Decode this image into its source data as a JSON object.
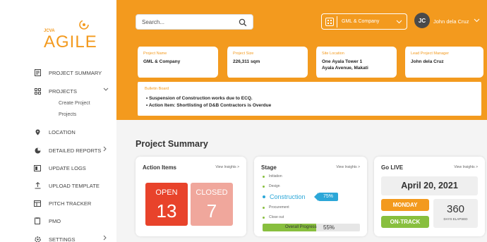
{
  "logo": {
    "small": "JCVA",
    "big": "AGILE"
  },
  "nav": {
    "items": [
      {
        "label": "PROJECT SUMMARY",
        "icon": "document-icon"
      },
      {
        "label": "PROJECTS",
        "icon": "grid-icon"
      },
      {
        "label": "LOCATION",
        "icon": "location-pin-icon"
      },
      {
        "label": "DETAILED REPORTS",
        "icon": "report-icon"
      },
      {
        "label": "UPDATE LOGS",
        "icon": "log-icon"
      },
      {
        "label": "UPLOAD TEMPLATE",
        "icon": "upload-icon"
      },
      {
        "label": "PITCH TRACKER",
        "icon": "tracker-icon"
      },
      {
        "label": "PMO",
        "icon": "clipboard-icon"
      },
      {
        "label": "SETTINGS",
        "icon": "gear-icon"
      }
    ],
    "sub_items": [
      "Create Project",
      "Projects"
    ]
  },
  "header": {
    "search_placeholder": "Search...",
    "company": "GML & Company",
    "avatar_initials": "JC",
    "username": "John dela Cruz"
  },
  "info_cards": [
    {
      "label": "Project Name",
      "value": "GML & Company"
    },
    {
      "label": "Project Size",
      "value": "226,311 sqm"
    },
    {
      "label": "Site Location",
      "value": "One Ayala Tower 1\nAyala Avenue, Makati"
    },
    {
      "label": "Lead Project Manager",
      "value": "John dela Cruz"
    }
  ],
  "bulletin": {
    "label": "Bulletin Board",
    "lines": [
      "• Suspension of Construction works due to ECQ.",
      "• Action Item: Shortlisting of D&B Contractors is Overdue"
    ]
  },
  "section_title": "Project Summary",
  "action_items": {
    "title": "Action Items",
    "view_insights": "View Insights >",
    "open_label": "OPEN",
    "open_count": "13",
    "closed_label": "CLOSED",
    "closed_count": "7",
    "colors": {
      "open": "#e8432b",
      "closed": "#f0a79c"
    }
  },
  "stage": {
    "title": "Stage",
    "view_insights": "View Insights >",
    "stages": [
      "Initiation",
      "Design",
      "Construction",
      "Procurement",
      "Close out"
    ],
    "active_stage": "Construction",
    "active_pct": "75%",
    "overall_label": "Overall Progress",
    "overall_value": "55%",
    "overall_fraction": 0.55
  },
  "go_live": {
    "title": "Go LIVE",
    "view_insights": "View Insights >",
    "date": "April 20, 2021",
    "day": "MONDAY",
    "status": "ON-TRACK",
    "days": "360",
    "days_label": "DAYS ELAPSED"
  },
  "colors": {
    "accent": "#f39a1e",
    "green": "#88bf3e",
    "blue": "#2ca7d8"
  }
}
